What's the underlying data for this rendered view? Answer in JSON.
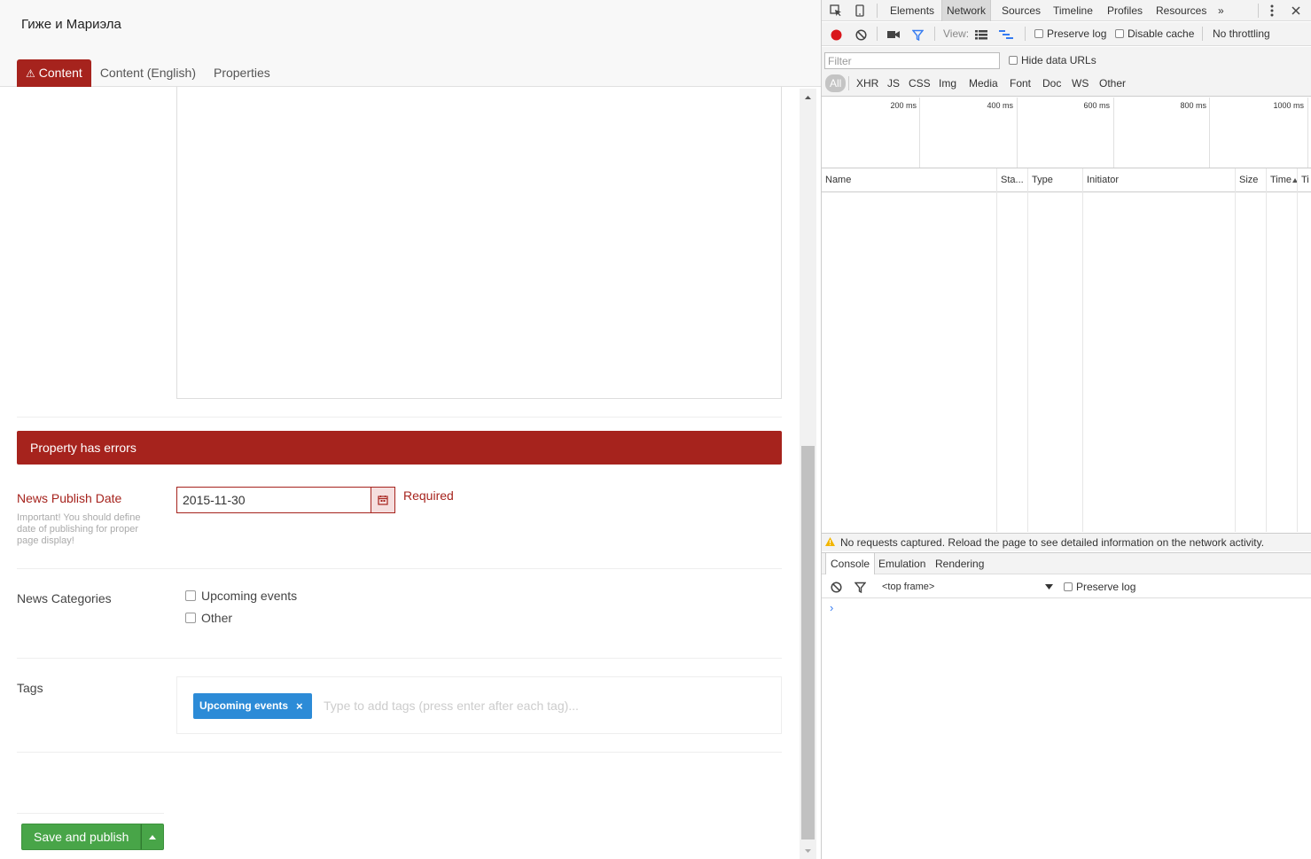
{
  "app": {
    "page_name": "Гиже и Мариэла",
    "tabs": [
      {
        "label": "Content",
        "warn_icon": "⚠"
      },
      {
        "label": "Content (English)"
      },
      {
        "label": "Properties"
      }
    ],
    "error_banner": "Property has errors",
    "publish_date": {
      "label": "News Publish Date",
      "description": "Important! You should define date of publishing for proper page display!",
      "value": "2015-11-30",
      "validation": "Required"
    },
    "categories": {
      "label": "News Categories",
      "options": [
        "Upcoming events",
        "Other"
      ]
    },
    "tags": {
      "label": "Tags",
      "chips": [
        "Upcoming events"
      ],
      "remove_glyph": "×",
      "placeholder": "Type to add tags (press enter after each tag)..."
    },
    "save_button": "Save and publish",
    "colors": {
      "error": "#a6231d",
      "tag": "#2c8bd7",
      "save": "#48a548"
    }
  },
  "devtools": {
    "tabs": [
      "Elements",
      "Network",
      "Sources",
      "Timeline",
      "Profiles",
      "Resources"
    ],
    "more": "»",
    "toolbar": {
      "view_label": "View:",
      "preserve_log": "Preserve log",
      "disable_cache": "Disable cache",
      "throttling": "No throttling"
    },
    "filter_placeholder": "Filter",
    "hide_data_urls": "Hide data URLs",
    "type_filters": [
      "All",
      "XHR",
      "JS",
      "CSS",
      "Img",
      "Media",
      "Font",
      "Doc",
      "WS",
      "Other"
    ],
    "timeline_ticks": [
      "200 ms",
      "400 ms",
      "600 ms",
      "800 ms",
      "1000 ms"
    ],
    "columns": [
      "Name",
      "Sta...",
      "Type",
      "Initiator",
      "Size",
      "Time",
      "Ti"
    ],
    "status_message": "No requests captured. Reload the page to see detailed information on the network activity.",
    "drawer_tabs": [
      "Console",
      "Emulation",
      "Rendering"
    ],
    "console": {
      "frame": "<top frame>",
      "preserve_log": "Preserve log",
      "prompt": "›"
    }
  }
}
